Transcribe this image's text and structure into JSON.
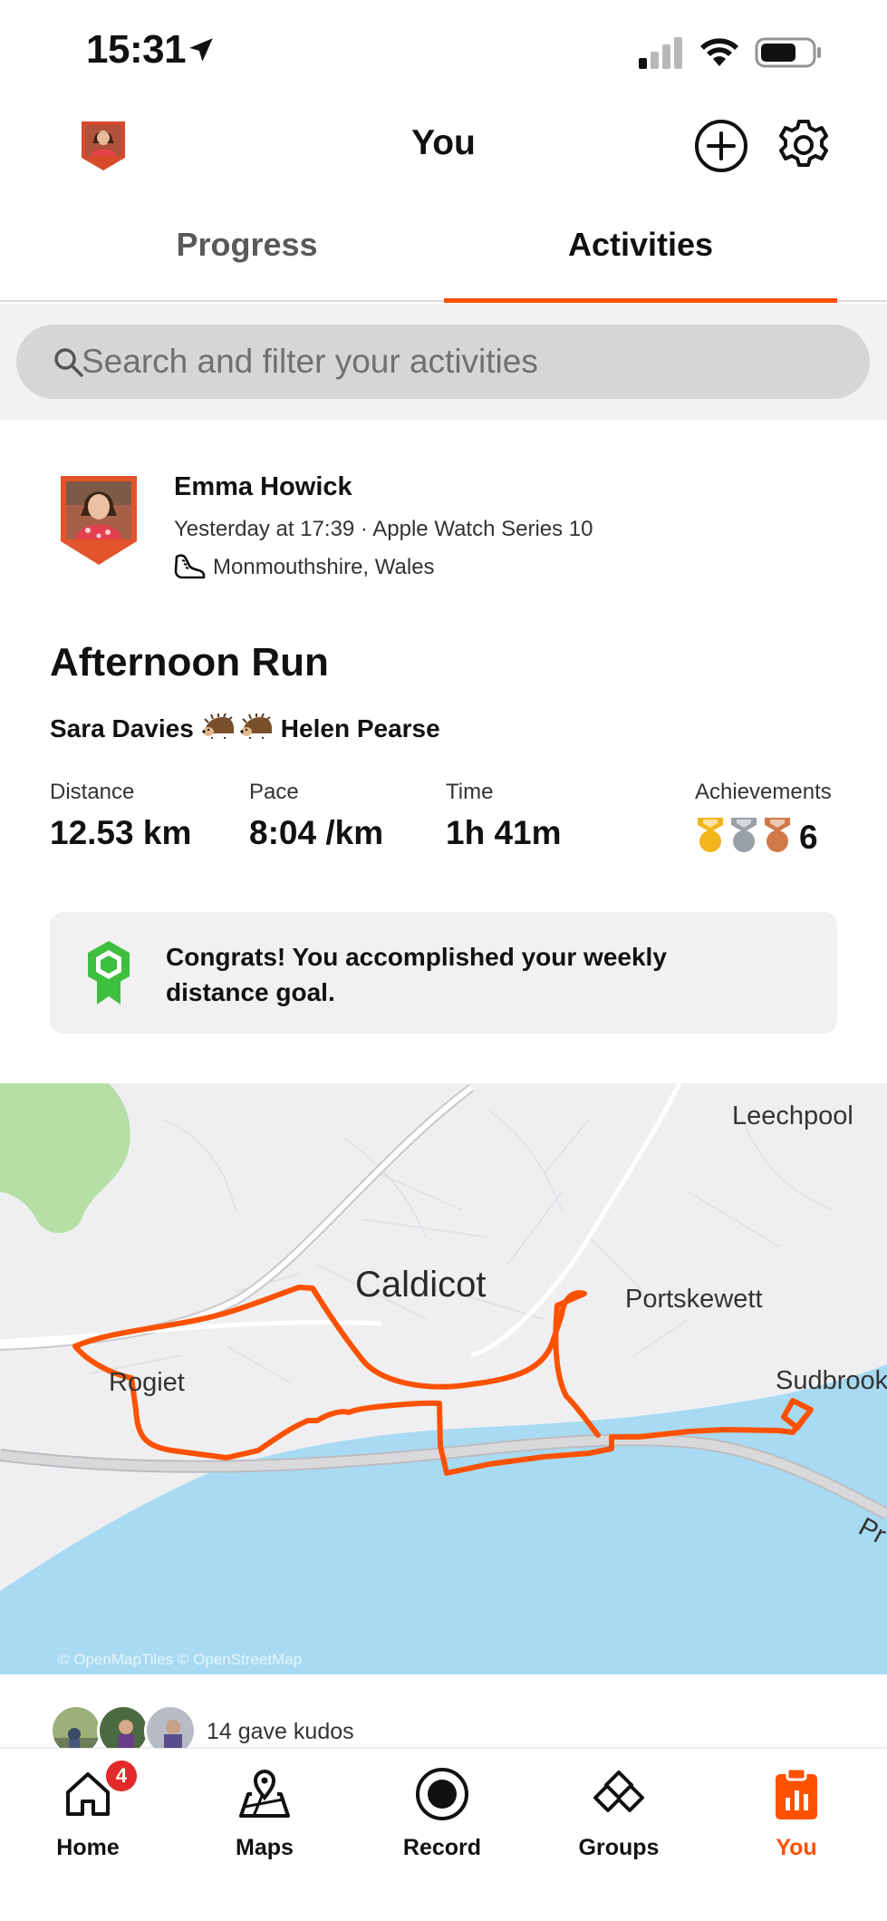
{
  "status_bar": {
    "time": "15:31",
    "icons": [
      "location-arrow-icon",
      "cellular-signal-icon",
      "wifi-icon",
      "battery-icon"
    ]
  },
  "header": {
    "title": "You",
    "actions": [
      "add-icon",
      "gear-icon"
    ]
  },
  "tabs": [
    {
      "label": "Progress",
      "active": false
    },
    {
      "label": "Activities",
      "active": true
    }
  ],
  "search": {
    "placeholder": "Search and filter your activities"
  },
  "activity": {
    "athlete_name": "Emma Howick",
    "meta": "Yesterday at 17:39 · Apple Watch Series 10",
    "location": "Monmouthshire, Wales",
    "title": "Afternoon Run",
    "companions": [
      "Sara Davies",
      "Helen Pearse"
    ],
    "stats": {
      "distance_label": "Distance",
      "distance_value": "12.53 km",
      "pace_label": "Pace",
      "pace_value": "8:04 /km",
      "time_label": "Time",
      "time_value": "1h 41m",
      "achievements_label": "Achievements",
      "achievements_count": "6"
    },
    "goal_message": "Congrats! You accomplished your weekly distance goal.",
    "map": {
      "labels": {
        "caldicot": "Caldicot",
        "leechpool": "Leechpool",
        "portskewett": "Portskewett",
        "rogiet": "Rogiet",
        "sudbrook": "Sudbrook",
        "road_edge": "Pr"
      },
      "attribution": "© OpenMapTiles © OpenStreetMap",
      "route_color": "#fc5200",
      "water_color": "#a8daf3",
      "land_color": "#efeff1"
    },
    "kudos_text": "14 gave kudos"
  },
  "bottom_nav": [
    {
      "label": "Home",
      "icon": "home-icon",
      "badge": "4"
    },
    {
      "label": "Maps",
      "icon": "map-icon"
    },
    {
      "label": "Record",
      "icon": "record-icon"
    },
    {
      "label": "Groups",
      "icon": "groups-icon"
    },
    {
      "label": "You",
      "icon": "clipboard-chart-icon",
      "active": true
    }
  ],
  "colors": {
    "accent": "#fc5200",
    "goal_green": "#3fbf3f",
    "gold": "#f3b51c",
    "silver": "#9aa1a6",
    "bronze": "#d07a4a"
  }
}
